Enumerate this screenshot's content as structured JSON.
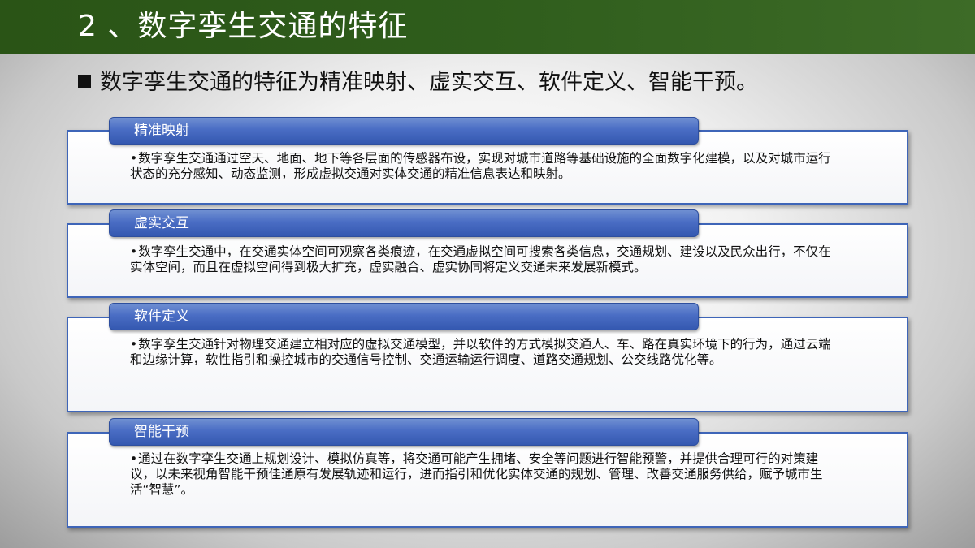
{
  "header": {
    "title": "2 、数字孪生交通的特征"
  },
  "subtitle": "数字孪生交通的特征为精准映射、虚实交互、软件定义、智能干预。",
  "cards": [
    {
      "label": "精准映射",
      "text": "数字孪生交通通过空天、地面、地下等各层面的传感器布设，实现对城市道路等基础设施的全面数字化建模，以及对城市运行状态的充分感知、动态监测，形成虚拟交通对实体交通的精准信息表达和映射。"
    },
    {
      "label": "虚实交互",
      "text": "数字孪生交通中，在交通实体空间可观察各类痕迹，在交通虚拟空间可搜索各类信息，交通规划、建设以及民众出行，不仅在实体空间，而且在虚拟空间得到极大扩充，虚实融合、虚实协同将定义交通未来发展新模式。"
    },
    {
      "label": "软件定义",
      "text": "数字孪生交通针对物理交通建立相对应的虚拟交通模型，并以软件的方式模拟交通人、车、路在真实环境下的行为，通过云端和边缘计算，软性指引和操控城市的交通信号控制、交通运输运行调度、道路交通规划、公交线路优化等。"
    },
    {
      "label": "智能干预",
      "text": "通过在数字孪生交通上规划设计、模拟仿真等，将交通可能产生拥堵、安全等问题进行智能预警，并提供合理可行的对策建议，以未来视角智能干预佳通原有发展轨迹和运行，进而指引和优化实体交通的规划、管理、改善交通服务供给，赋予城市生活“智慧”。"
    }
  ]
}
